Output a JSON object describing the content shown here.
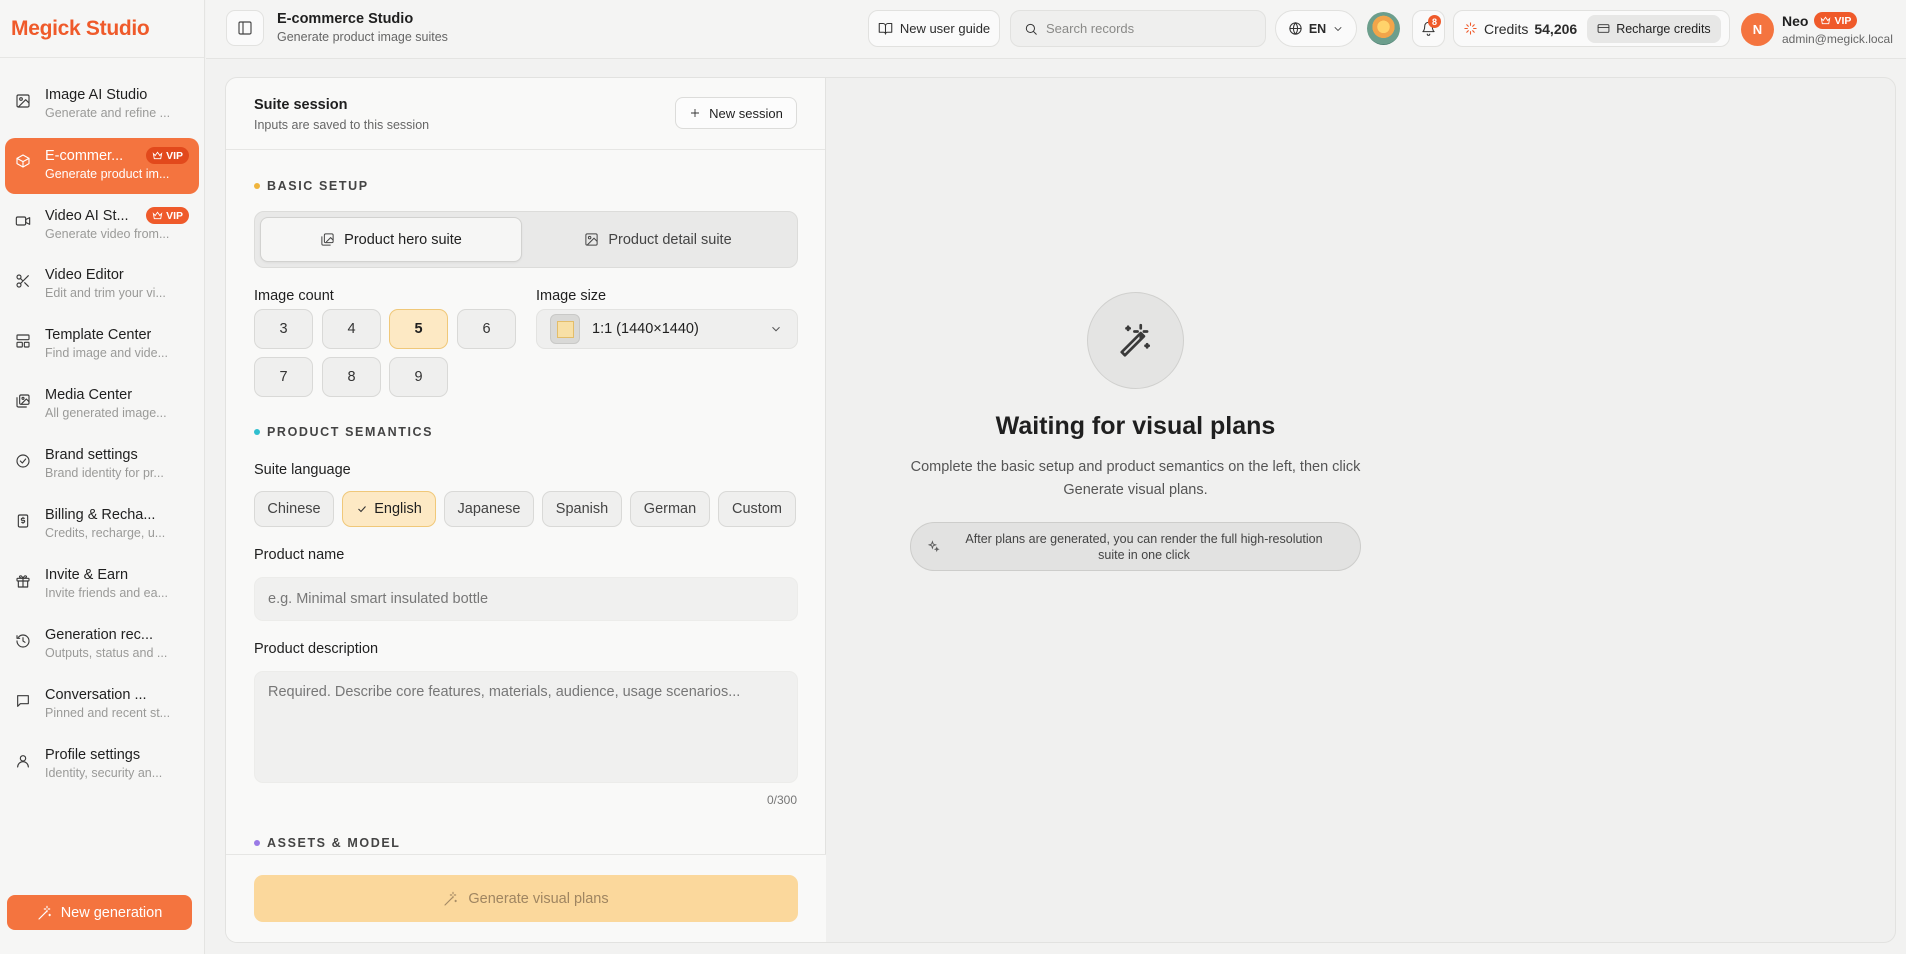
{
  "brand": "Megick Studio",
  "sidebar": {
    "items": [
      {
        "title": "Image AI Studio",
        "sub": "Generate and refine ...",
        "vip": ""
      },
      {
        "title": "E-commer...",
        "sub": "Generate product im...",
        "vip": "VIP"
      },
      {
        "title": "Video AI St...",
        "sub": "Generate video from...",
        "vip": "VIP"
      },
      {
        "title": "Video Editor",
        "sub": "Edit and trim your vi...",
        "vip": ""
      },
      {
        "title": "Template Center",
        "sub": "Find image and vide...",
        "vip": ""
      },
      {
        "title": "Media Center",
        "sub": "All generated image...",
        "vip": ""
      },
      {
        "title": "Brand settings",
        "sub": "Brand identity for pr...",
        "vip": ""
      },
      {
        "title": "Billing & Recha...",
        "sub": "Credits, recharge, u...",
        "vip": ""
      },
      {
        "title": "Invite & Earn",
        "sub": "Invite friends and ea...",
        "vip": ""
      },
      {
        "title": "Generation rec...",
        "sub": "Outputs, status and ...",
        "vip": ""
      },
      {
        "title": "Conversation ...",
        "sub": "Pinned and recent st...",
        "vip": ""
      },
      {
        "title": "Profile settings",
        "sub": "Identity, security an...",
        "vip": ""
      }
    ],
    "new_generation": "New generation"
  },
  "header": {
    "title": "E-commerce Studio",
    "subtitle": "Generate product image suites",
    "guide": "New user guide",
    "search_placeholder": "Search records",
    "lang": "EN",
    "notifications": "8",
    "credits_label": "Credits",
    "credits_amount": "54,206",
    "recharge": "Recharge credits",
    "user_initial": "N",
    "user_name": "Neo",
    "user_vip": "VIP",
    "user_email": "admin@megick.local"
  },
  "session": {
    "title": "Suite session",
    "subtitle": "Inputs are saved to this session",
    "new_session": "New session"
  },
  "basic": {
    "section": "BASIC SETUP",
    "suite_on": "Product hero suite",
    "suite_off": "Product detail suite",
    "count_label": "Image count",
    "counts": [
      "3",
      "4",
      "5",
      "6",
      "7",
      "8",
      "9"
    ],
    "count_selected": "5",
    "size_label": "Image size",
    "size_value": "1:1 (1440×1440)"
  },
  "semantics": {
    "section": "PRODUCT SEMANTICS",
    "lang_label": "Suite language",
    "languages": [
      "Chinese",
      "English",
      "Japanese",
      "Spanish",
      "German",
      "Custom"
    ],
    "lang_selected": "English",
    "name_label": "Product name",
    "name_placeholder": "e.g. Minimal smart insulated bottle",
    "desc_label": "Product description",
    "desc_placeholder": "Required. Describe core features, materials, audience, usage scenarios...",
    "desc_counter": "0/300"
  },
  "assets": {
    "section": "ASSETS & MODEL"
  },
  "generate": "Generate visual plans",
  "waiting": {
    "title": "Waiting for visual plans",
    "subtitle": "Complete the basic setup and product semantics on the left, then click Generate visual plans.",
    "note": "After plans are generated, you can render the full high-resolution suite in one click"
  },
  "colors": {
    "accent": "#f4743f",
    "brand": "#ef5a2a",
    "selected_bg": "#fde9c4",
    "dot_basic": "#f0b53d",
    "dot_semantics": "#2fbfcf",
    "dot_assets": "#9a7be6"
  }
}
